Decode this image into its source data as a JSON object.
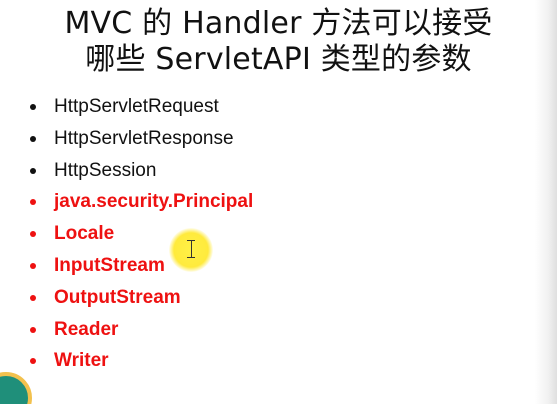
{
  "slide": {
    "title_line_1": "MVC 的 Handler 方法可以接受",
    "title_line_2": "哪些 ServletAPI 类型的参数",
    "items": [
      {
        "label": "HttpServletRequest",
        "highlight": false
      },
      {
        "label": "HttpServletResponse",
        "highlight": false
      },
      {
        "label": "HttpSession",
        "highlight": false
      },
      {
        "label": "java.security.Principal",
        "highlight": true
      },
      {
        "label": "Locale",
        "highlight": true
      },
      {
        "label": "InputStream",
        "highlight": true
      },
      {
        "label": "OutputStream",
        "highlight": true
      },
      {
        "label": "Reader",
        "highlight": true
      },
      {
        "label": "Writer",
        "highlight": true
      }
    ]
  },
  "colors": {
    "normal_text": "#111111",
    "highlight_text": "#ee1111",
    "cursor_halo": "#ffe830",
    "corner_deco": "#1f8f7a",
    "corner_deco_ring": "#f2c14e"
  },
  "icons": {
    "cursor": "text-cursor-icon",
    "bullet": "bullet-dot-icon"
  }
}
